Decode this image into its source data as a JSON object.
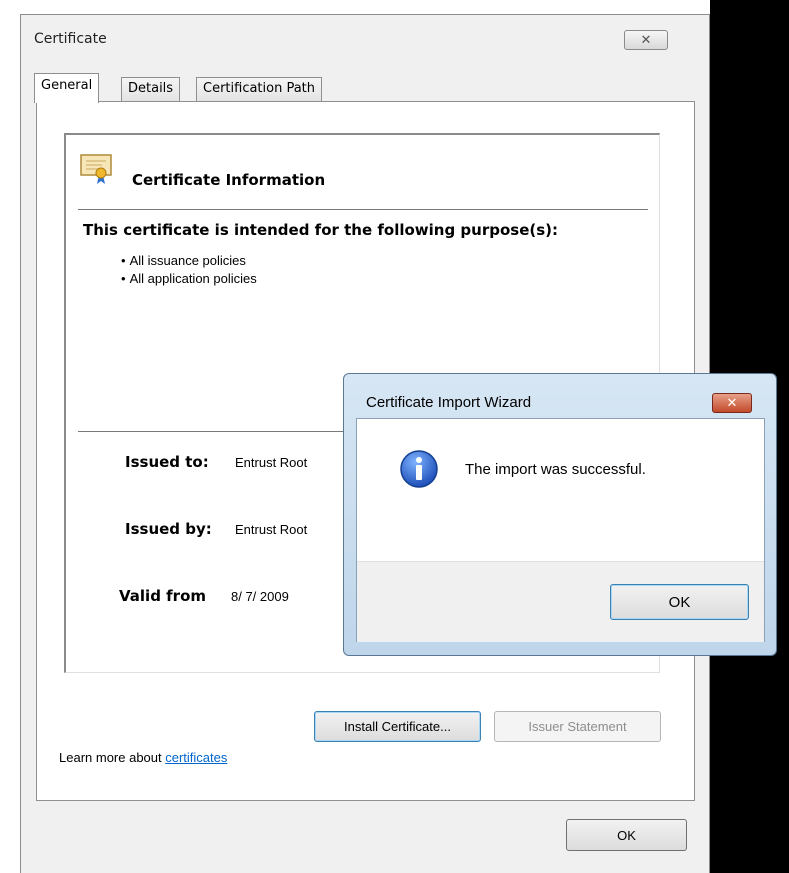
{
  "certificate": {
    "title": "Certificate",
    "close_label": "✕",
    "tabs": [
      {
        "label": "General",
        "active": true
      },
      {
        "label": "Details",
        "active": false
      },
      {
        "label": "Certification Path",
        "active": false
      }
    ],
    "info_heading": "Certificate Information",
    "purpose_heading": "This certificate is intended for the following purpose(s):",
    "purposes": [
      "All issuance policies",
      "All application policies"
    ],
    "issued_to_label": "Issued to:",
    "issued_to_value": "Entrust Root",
    "issued_by_label": "Issued by:",
    "issued_by_value": "Entrust Root",
    "valid_from_label": "Valid from",
    "valid_from_value": "8/ 7/ 2009",
    "install_button": "Install Certificate...",
    "issuer_statement_button": "Issuer Statement",
    "learn_more_text": "Learn more about ",
    "learn_more_link": "certificates",
    "ok_button": "OK"
  },
  "wizard": {
    "title": "Certificate Import Wizard",
    "close_label": "✕",
    "message": "The import was successful.",
    "ok_button": "OK"
  }
}
